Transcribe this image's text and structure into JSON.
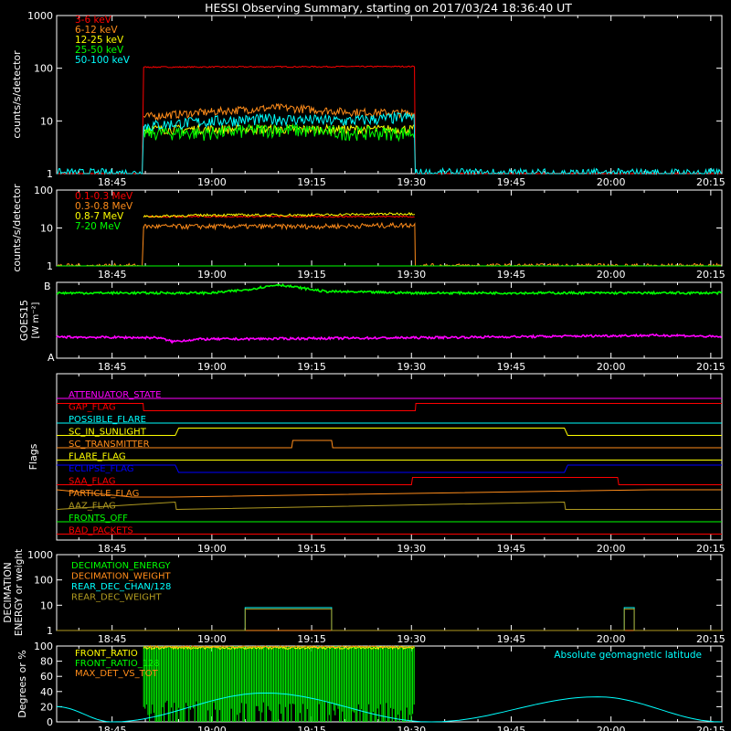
{
  "title": "HESSI Observing Summary, starting on 2017/03/24 18:36:40 UT",
  "time_ticks": [
    "18:45",
    "19:00",
    "19:15",
    "19:30",
    "19:45",
    "20:00",
    "20:15"
  ],
  "colors": {
    "red": "#ff0000",
    "orange": "#ff8c1a",
    "yellow": "#ffff00",
    "green": "#00ff00",
    "cyan": "#00ffff",
    "magenta": "#ff00ff",
    "blue": "#0000ff",
    "olive": "#b09a20",
    "white": "#ffffff"
  },
  "chart_data": [
    {
      "id": "lightcurves",
      "type": "line",
      "ylabel": "counts/s/detector",
      "yscale": "log",
      "ylim": [
        1,
        1000
      ],
      "yticks": [
        "1",
        "10",
        "100",
        "1000"
      ],
      "x_range": [
        "18:36:40",
        "20:16:40"
      ],
      "legend": "top-left",
      "series": [
        {
          "name": "3-6 keV",
          "color": "red",
          "x": [
            "18:36:40",
            "18:49:40",
            "18:49:45",
            "19:30:30",
            "19:30:35",
            "20:16:40"
          ],
          "y": [
            1,
            1,
            105,
            108,
            1,
            1
          ]
        },
        {
          "name": "6-12 keV",
          "color": "orange",
          "x": [
            "18:49:45",
            "19:00",
            "19:10",
            "19:20",
            "19:30:30"
          ],
          "y": [
            12,
            15,
            18,
            15,
            14
          ]
        },
        {
          "name": "12-25 keV",
          "color": "yellow",
          "x": [
            "18:49:45",
            "19:30:30"
          ],
          "y": [
            7,
            7
          ]
        },
        {
          "name": "25-50 keV",
          "color": "green",
          "x": [
            "18:49:45",
            "19:00",
            "19:10",
            "19:20",
            "19:30:30"
          ],
          "y": [
            6,
            6,
            7,
            6,
            6
          ]
        },
        {
          "name": "50-100 keV",
          "color": "cyan",
          "x": [
            "18:36:40",
            "18:49:40",
            "18:49:45",
            "19:00",
            "19:10",
            "19:20",
            "19:30:30",
            "19:30:35",
            "20:16:40"
          ],
          "y": [
            1,
            1,
            8,
            10,
            11,
            10,
            12,
            1,
            1
          ]
        }
      ]
    },
    {
      "id": "lightcurves_high",
      "type": "line",
      "ylabel": "counts/s/detector",
      "yscale": "log",
      "ylim": [
        1,
        100
      ],
      "yticks": [
        "1",
        "10",
        "100"
      ],
      "legend": "top-left",
      "series": [
        {
          "name": "0.1-0.3 MeV",
          "color": "red",
          "x": [
            "18:49:45",
            "19:30:30"
          ],
          "y": [
            20,
            20
          ]
        },
        {
          "name": "0.3-0.8 MeV",
          "color": "orange",
          "x": [
            "18:36:40",
            "18:49:40",
            "18:49:45",
            "19:00",
            "19:15",
            "19:30:30",
            "19:30:35",
            "20:16:40"
          ],
          "y": [
            1,
            1,
            11,
            11,
            11,
            12,
            1,
            1
          ]
        },
        {
          "name": "0.8-7 MeV",
          "color": "yellow",
          "x": [
            "18:49:45",
            "19:00",
            "19:15",
            "19:30:30"
          ],
          "y": [
            20,
            22,
            22,
            24
          ]
        },
        {
          "name": "7-20 MeV",
          "color": "green",
          "x": [
            "18:36:40",
            "20:16:40"
          ],
          "y": [
            1,
            1
          ]
        }
      ]
    },
    {
      "id": "goes",
      "type": "line",
      "ylabel": "GOES15",
      "ylabel2": "[W m⁻²]",
      "yticks": [
        "A",
        "B"
      ],
      "series": [
        {
          "name": "GOES long",
          "color": "green",
          "x": [
            "18:36:40",
            "19:00",
            "19:05",
            "19:10",
            "19:17",
            "19:30",
            "20:16:40"
          ],
          "y": [
            0.86,
            0.86,
            0.9,
            0.97,
            0.88,
            0.86,
            0.86
          ]
        },
        {
          "name": "GOES short",
          "color": "magenta",
          "x": [
            "18:36:40",
            "18:52",
            "18:54",
            "18:58",
            "19:30",
            "20:05",
            "20:10",
            "20:16:40"
          ],
          "y": [
            0.28,
            0.27,
            0.22,
            0.25,
            0.27,
            0.3,
            0.3,
            0.28
          ]
        }
      ]
    },
    {
      "id": "flags",
      "type": "line",
      "ylabel": "Flags",
      "series": [
        {
          "name": "ATTENUATOR_STATE",
          "color": "magenta",
          "x": [
            "18:36:40",
            "20:16:40"
          ],
          "y": [
            0,
            0
          ]
        },
        {
          "name": "GAP_FLAG",
          "color": "red",
          "x": [
            "18:36:40",
            "18:49:40",
            "18:49:45",
            "19:30:35",
            "19:30:40",
            "20:16:40"
          ],
          "y": [
            1,
            1,
            0,
            0,
            1,
            1
          ]
        },
        {
          "name": "POSSIBLE_FLARE",
          "color": "cyan",
          "x": [
            "18:36:40",
            "20:16:40"
          ],
          "y": [
            0,
            0
          ]
        },
        {
          "name": "SC_IN_SUNLIGHT",
          "color": "yellow",
          "x": [
            "18:36:40",
            "18:54:30",
            "18:55",
            "19:53:00",
            "19:53:30",
            "20:16:40"
          ],
          "y": [
            0,
            0,
            1,
            1,
            0,
            0
          ]
        },
        {
          "name": "SC_TRANSMITTER",
          "color": "orange",
          "x": [
            "18:36:40",
            "19:12",
            "19:12:10",
            "19:18",
            "19:18:10",
            "20:16:40"
          ],
          "y": [
            0,
            0,
            1,
            1,
            0,
            0
          ]
        },
        {
          "name": "FLARE_FLAG",
          "color": "yellow",
          "x": [
            "18:36:40",
            "20:16:40"
          ],
          "y": [
            0,
            0
          ]
        },
        {
          "name": "ECLIPSE_FLAG",
          "color": "blue",
          "x": [
            "18:36:40",
            "18:54:30",
            "18:55",
            "19:53:00",
            "19:53:30",
            "20:16:40"
          ],
          "y": [
            1,
            1,
            0,
            0,
            1,
            1
          ]
        },
        {
          "name": "SAA_FLAG",
          "color": "red",
          "x": [
            "18:36:40",
            "19:30",
            "19:30:10",
            "20:01",
            "20:01:10",
            "20:16:40"
          ],
          "y": [
            0,
            0,
            1,
            1,
            0,
            0
          ]
        },
        {
          "name": "PARTICLE_FLAG",
          "color": "orange",
          "x": [
            "18:36:40",
            "18:48",
            "18:54",
            "20:06",
            "20:16:40"
          ],
          "y": [
            1,
            0,
            0,
            1,
            1
          ]
        },
        {
          "name": "AAZ_FLAG",
          "color": "olive",
          "x": [
            "18:36:40",
            "18:54:30",
            "18:54:40",
            "19:53:00",
            "19:53:10",
            "20:16:40"
          ],
          "y": [
            0,
            1,
            0,
            1,
            0,
            0
          ]
        },
        {
          "name": "FRONTS_OFF",
          "color": "green",
          "x": [
            "18:36:40",
            "20:16:40"
          ],
          "y": [
            0,
            0
          ]
        },
        {
          "name": "BAD_PACKETS",
          "color": "red",
          "x": [
            "18:36:40",
            "20:16:40"
          ],
          "y": [
            0,
            0
          ]
        }
      ]
    },
    {
      "id": "decimation",
      "type": "line",
      "ylabel": "DECIMATION",
      "ylabel2": "ENERGY or weight",
      "yscale": "log",
      "ylim": [
        1,
        1000
      ],
      "yticks": [
        "1",
        "10",
        "100",
        "1000"
      ],
      "legend": "top-left",
      "series": [
        {
          "name": "DECIMATION_ENERGY",
          "color": "green",
          "x": [
            "18:36:40",
            "20:16:40"
          ],
          "y": [
            0,
            0
          ]
        },
        {
          "name": "DECIMATION_WEIGHT",
          "color": "orange",
          "x": [
            "18:36:40",
            "20:16:40"
          ],
          "y": [
            1,
            1
          ]
        },
        {
          "name": "REAR_DEC_CHAN/128",
          "color": "cyan",
          "x": [
            "19:05",
            "19:05",
            "19:18",
            "19:18",
            "20:02",
            "20:02",
            "20:03:30",
            "20:03:30"
          ],
          "y": [
            1,
            8,
            8,
            1,
            1,
            8,
            8,
            1
          ]
        },
        {
          "name": "REAR_DEC_WEIGHT",
          "color": "olive",
          "x": [
            "18:36:40",
            "19:05",
            "19:05",
            "19:18",
            "19:18",
            "20:02",
            "20:02",
            "20:03:30",
            "20:03:30",
            "20:16:40"
          ],
          "y": [
            1,
            1,
            7,
            7,
            1,
            1,
            7,
            7,
            1,
            1
          ]
        }
      ]
    },
    {
      "id": "ratios",
      "type": "line",
      "ylabel": "Degrees or %",
      "ylim": [
        0,
        100
      ],
      "yticks": [
        "0",
        "20",
        "40",
        "60",
        "80",
        "100"
      ],
      "legend": "top-left",
      "annotation": "Absolute geomagnetic latitude",
      "series": [
        {
          "name": "FRONT_RATIO",
          "color": "yellow",
          "x": [
            "18:49:45",
            "19:30:30"
          ],
          "y": [
            100,
            100
          ]
        },
        {
          "name": "FRONT_RATIO_128",
          "color": "green",
          "x": [
            "18:49:45",
            "19:30:30"
          ],
          "y": [
            100,
            100
          ]
        },
        {
          "name": "MAX_DET_VS_TOT",
          "color": "orange",
          "x": [
            "18:49:45",
            "19:30:30"
          ],
          "y": [
            100,
            100
          ]
        },
        {
          "name": "Absolute geomagnetic latitude",
          "color": "cyan",
          "x": [
            "18:36:40",
            "18:45",
            "19:08",
            "19:33",
            "19:58",
            "20:16:40"
          ],
          "y": [
            20,
            0,
            38,
            0,
            33,
            0
          ]
        }
      ]
    }
  ],
  "panels_text": {
    "lc_legend": [
      "3-6 keV",
      "6-12 keV",
      "12-25 keV",
      "25-50 keV",
      "50-100 keV"
    ],
    "lc2_legend": [
      "0.1-0.3 MeV",
      "0.3-0.8 MeV",
      "0.8-7 MeV",
      "7-20 MeV"
    ],
    "dec_legend": [
      "DECIMATION_ENERGY",
      "DECIMATION_WEIGHT",
      "REAR_DEC_CHAN/128",
      "REAR_DEC_WEIGHT"
    ],
    "ratio_legend": [
      "FRONT_RATIO",
      "FRONT_RATIO_128",
      "MAX_DET_VS_TOT"
    ]
  }
}
